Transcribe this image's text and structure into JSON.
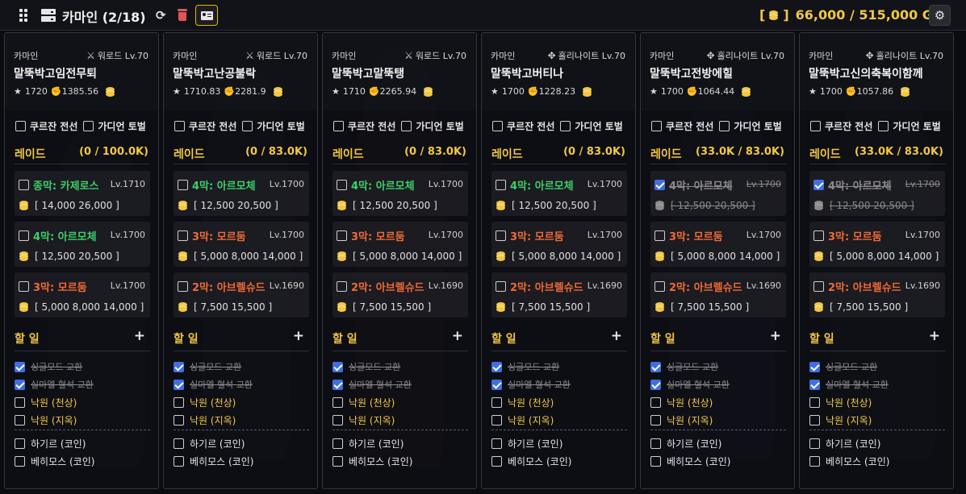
{
  "header": {
    "title": "카마인 (2/18)",
    "gold_open": "[",
    "gold_close": "]",
    "gold_text": "66,000 / 515,000 G"
  },
  "icons": {
    "menu": "grid-icon",
    "server": "server-icon",
    "refresh": "refresh-icon",
    "delete": "trash-icon",
    "card": "id-card-icon",
    "settings": "gear-icon",
    "gold": "gold-coin-icon",
    "ilvl": "star-icon",
    "combat": "fist-icon",
    "warlord_job": "warlord-class-icon",
    "holyknight_job": "holyknight-class-icon"
  },
  "colors": {
    "accent_gold": "#f2c744",
    "green": "#3ecf6a",
    "orange": "#f06a35",
    "check": "#3f6fe0"
  },
  "characters": [
    {
      "server": "카마인",
      "job": "워로드 Lv.70",
      "name": "말뚝박고임전무퇴",
      "ilvl": "1720",
      "power": "1385.56",
      "toggle_a": "쿠르잔 전선",
      "toggle_b": "가디언 토벌",
      "raid_label": "레이드",
      "raid_count": "(0 / 100.0K)",
      "raids": [
        {
          "title": "종막: 카제로스",
          "lv": "Lv.1710",
          "gold": "[ 14,000  26,000 ]",
          "color": "g",
          "done": false
        },
        {
          "title": "4막: 아르모체",
          "lv": "Lv.1700",
          "gold": "[ 12,500  20,500 ]",
          "color": "g",
          "done": false
        },
        {
          "title": "3막: 모르둠",
          "lv": "Lv.1700",
          "gold": "[ 5,000  8,000  14,000 ]",
          "color": "o",
          "done": false
        }
      ],
      "todo_label": "할 일",
      "plus": "+",
      "todos": [
        {
          "text": "싱글모드 교환",
          "done": true,
          "tone": "s"
        },
        {
          "text": "실마엘 혈석 교환",
          "done": true,
          "tone": "s"
        },
        {
          "text": "낙원 (천상)",
          "done": false,
          "tone": "y"
        },
        {
          "text": "낙원 (지옥)",
          "done": false,
          "tone": "y"
        },
        {
          "text": "하기르 (코인)",
          "done": false,
          "tone": "w"
        },
        {
          "text": "베히모스 (코인)",
          "done": false,
          "tone": "w"
        }
      ]
    },
    {
      "server": "카마인",
      "job": "워로드 Lv.70",
      "name": "말뚝박고난공불락",
      "ilvl": "1710.83",
      "power": "2281.9",
      "toggle_a": "쿠르잔 전선",
      "toggle_b": "가디언 토벌",
      "raid_label": "레이드",
      "raid_count": "(0 / 83.0K)",
      "raids": [
        {
          "title": "4막: 아르모체",
          "lv": "Lv.1700",
          "gold": "[ 12,500  20,500 ]",
          "color": "g",
          "done": false
        },
        {
          "title": "3막: 모르둠",
          "lv": "Lv.1700",
          "gold": "[ 5,000  8,000  14,000 ]",
          "color": "o",
          "done": false
        },
        {
          "title": "2막: 아브렐슈드",
          "lv": "Lv.1690",
          "gold": "[ 7,500  15,500 ]",
          "color": "o",
          "done": false
        }
      ],
      "todo_label": "할 일",
      "plus": "+",
      "todos": [
        {
          "text": "싱글모드 교환",
          "done": true,
          "tone": "s"
        },
        {
          "text": "실마엘 혈석 교환",
          "done": true,
          "tone": "s"
        },
        {
          "text": "낙원 (천상)",
          "done": false,
          "tone": "y"
        },
        {
          "text": "낙원 (지옥)",
          "done": false,
          "tone": "y"
        },
        {
          "text": "하기르 (코인)",
          "done": false,
          "tone": "w"
        },
        {
          "text": "베히모스 (코인)",
          "done": false,
          "tone": "w"
        }
      ]
    },
    {
      "server": "카마인",
      "job": "워로드 Lv.70",
      "name": "말뚝박고말뚝탱",
      "ilvl": "1710",
      "power": "2265.94",
      "toggle_a": "쿠르잔 전선",
      "toggle_b": "가디언 토벌",
      "raid_label": "레이드",
      "raid_count": "(0 / 83.0K)",
      "raids": [
        {
          "title": "4막: 아르모체",
          "lv": "Lv.1700",
          "gold": "[ 12,500  20,500 ]",
          "color": "g",
          "done": false
        },
        {
          "title": "3막: 모르둠",
          "lv": "Lv.1700",
          "gold": "[ 5,000  8,000  14,000 ]",
          "color": "o",
          "done": false
        },
        {
          "title": "2막: 아브렐슈드",
          "lv": "Lv.1690",
          "gold": "[ 7,500  15,500 ]",
          "color": "o",
          "done": false
        }
      ],
      "todo_label": "할 일",
      "plus": "+",
      "todos": [
        {
          "text": "싱글모드 교환",
          "done": true,
          "tone": "s"
        },
        {
          "text": "실마엘 혈석 교환",
          "done": true,
          "tone": "s"
        },
        {
          "text": "낙원 (천상)",
          "done": false,
          "tone": "y"
        },
        {
          "text": "낙원 (지옥)",
          "done": false,
          "tone": "y"
        },
        {
          "text": "하기르 (코인)",
          "done": false,
          "tone": "w"
        },
        {
          "text": "베히모스 (코인)",
          "done": false,
          "tone": "w"
        }
      ]
    },
    {
      "server": "카마인",
      "job": "홀리나이트 Lv.70",
      "name": "말뚝박고버티나",
      "ilvl": "1700",
      "power": "1228.23",
      "toggle_a": "쿠르잔 전선",
      "toggle_b": "가디언 토벌",
      "raid_label": "레이드",
      "raid_count": "(0 / 83.0K)",
      "raids": [
        {
          "title": "4막: 아르모체",
          "lv": "Lv.1700",
          "gold": "[ 12,500  20,500 ]",
          "color": "g",
          "done": false
        },
        {
          "title": "3막: 모르둠",
          "lv": "Lv.1700",
          "gold": "[ 5,000  8,000  14,000 ]",
          "color": "o",
          "done": false
        },
        {
          "title": "2막: 아브렐슈드",
          "lv": "Lv.1690",
          "gold": "[ 7,500  15,500 ]",
          "color": "o",
          "done": false
        }
      ],
      "todo_label": "할 일",
      "plus": "+",
      "todos": [
        {
          "text": "싱글모드 교환",
          "done": true,
          "tone": "s"
        },
        {
          "text": "실마엘 혈석 교환",
          "done": true,
          "tone": "s"
        },
        {
          "text": "낙원 (천상)",
          "done": false,
          "tone": "y"
        },
        {
          "text": "낙원 (지옥)",
          "done": false,
          "tone": "y"
        },
        {
          "text": "하기르 (코인)",
          "done": false,
          "tone": "w"
        },
        {
          "text": "베히모스 (코인)",
          "done": false,
          "tone": "w"
        }
      ]
    },
    {
      "server": "카마인",
      "job": "홀리나이트 Lv.70",
      "name": "말뚝박고전방에힐",
      "ilvl": "1700",
      "power": "1064.44",
      "toggle_a": "쿠르잔 전선",
      "toggle_b": "가디언 토벌",
      "raid_label": "레이드",
      "raid_count": "(33.0K / 83.0K)",
      "raids": [
        {
          "title": "4막: 아르모체",
          "lv": "Lv.1700",
          "gold": "[ 12,500  20,500 ]",
          "color": "g",
          "done": true
        },
        {
          "title": "3막: 모르둠",
          "lv": "Lv.1700",
          "gold": "[ 5,000  8,000  14,000 ]",
          "color": "o",
          "done": false
        },
        {
          "title": "2막: 아브렐슈드",
          "lv": "Lv.1690",
          "gold": "[ 7,500  15,500 ]",
          "color": "o",
          "done": false
        }
      ],
      "todo_label": "할 일",
      "plus": "+",
      "todos": [
        {
          "text": "싱글모드 교환",
          "done": true,
          "tone": "s"
        },
        {
          "text": "실마엘 혈석 교환",
          "done": true,
          "tone": "s"
        },
        {
          "text": "낙원 (천상)",
          "done": false,
          "tone": "y"
        },
        {
          "text": "낙원 (지옥)",
          "done": false,
          "tone": "y"
        },
        {
          "text": "하기르 (코인)",
          "done": false,
          "tone": "w"
        },
        {
          "text": "베히모스 (코인)",
          "done": false,
          "tone": "w"
        }
      ]
    },
    {
      "server": "카마인",
      "job": "홀리나이트 Lv.70",
      "name": "말뚝박고신의축복이함께",
      "ilvl": "1700",
      "power": "1057.86",
      "toggle_a": "쿠르잔 전선",
      "toggle_b": "가디언 토벌",
      "raid_label": "레이드",
      "raid_count": "(33.0K / 83.0K)",
      "raids": [
        {
          "title": "4막: 아르모체",
          "lv": "Lv.1700",
          "gold": "[ 12,500  20,500 ]",
          "color": "g",
          "done": true
        },
        {
          "title": "3막: 모르둠",
          "lv": "Lv.1700",
          "gold": "[ 5,000  8,000  14,000 ]",
          "color": "o",
          "done": false
        },
        {
          "title": "2막: 아브렐슈드",
          "lv": "Lv.1690",
          "gold": "[ 7,500  15,500 ]",
          "color": "o",
          "done": false
        }
      ],
      "todo_label": "할 일",
      "plus": "+",
      "todos": [
        {
          "text": "싱글모드 교환",
          "done": true,
          "tone": "s"
        },
        {
          "text": "실마엘 혈석 교환",
          "done": true,
          "tone": "s"
        },
        {
          "text": "낙원 (천상)",
          "done": false,
          "tone": "y"
        },
        {
          "text": "낙원 (지옥)",
          "done": false,
          "tone": "y"
        },
        {
          "text": "하기르 (코인)",
          "done": false,
          "tone": "w"
        },
        {
          "text": "베히모스 (코인)",
          "done": false,
          "tone": "w"
        }
      ]
    }
  ]
}
